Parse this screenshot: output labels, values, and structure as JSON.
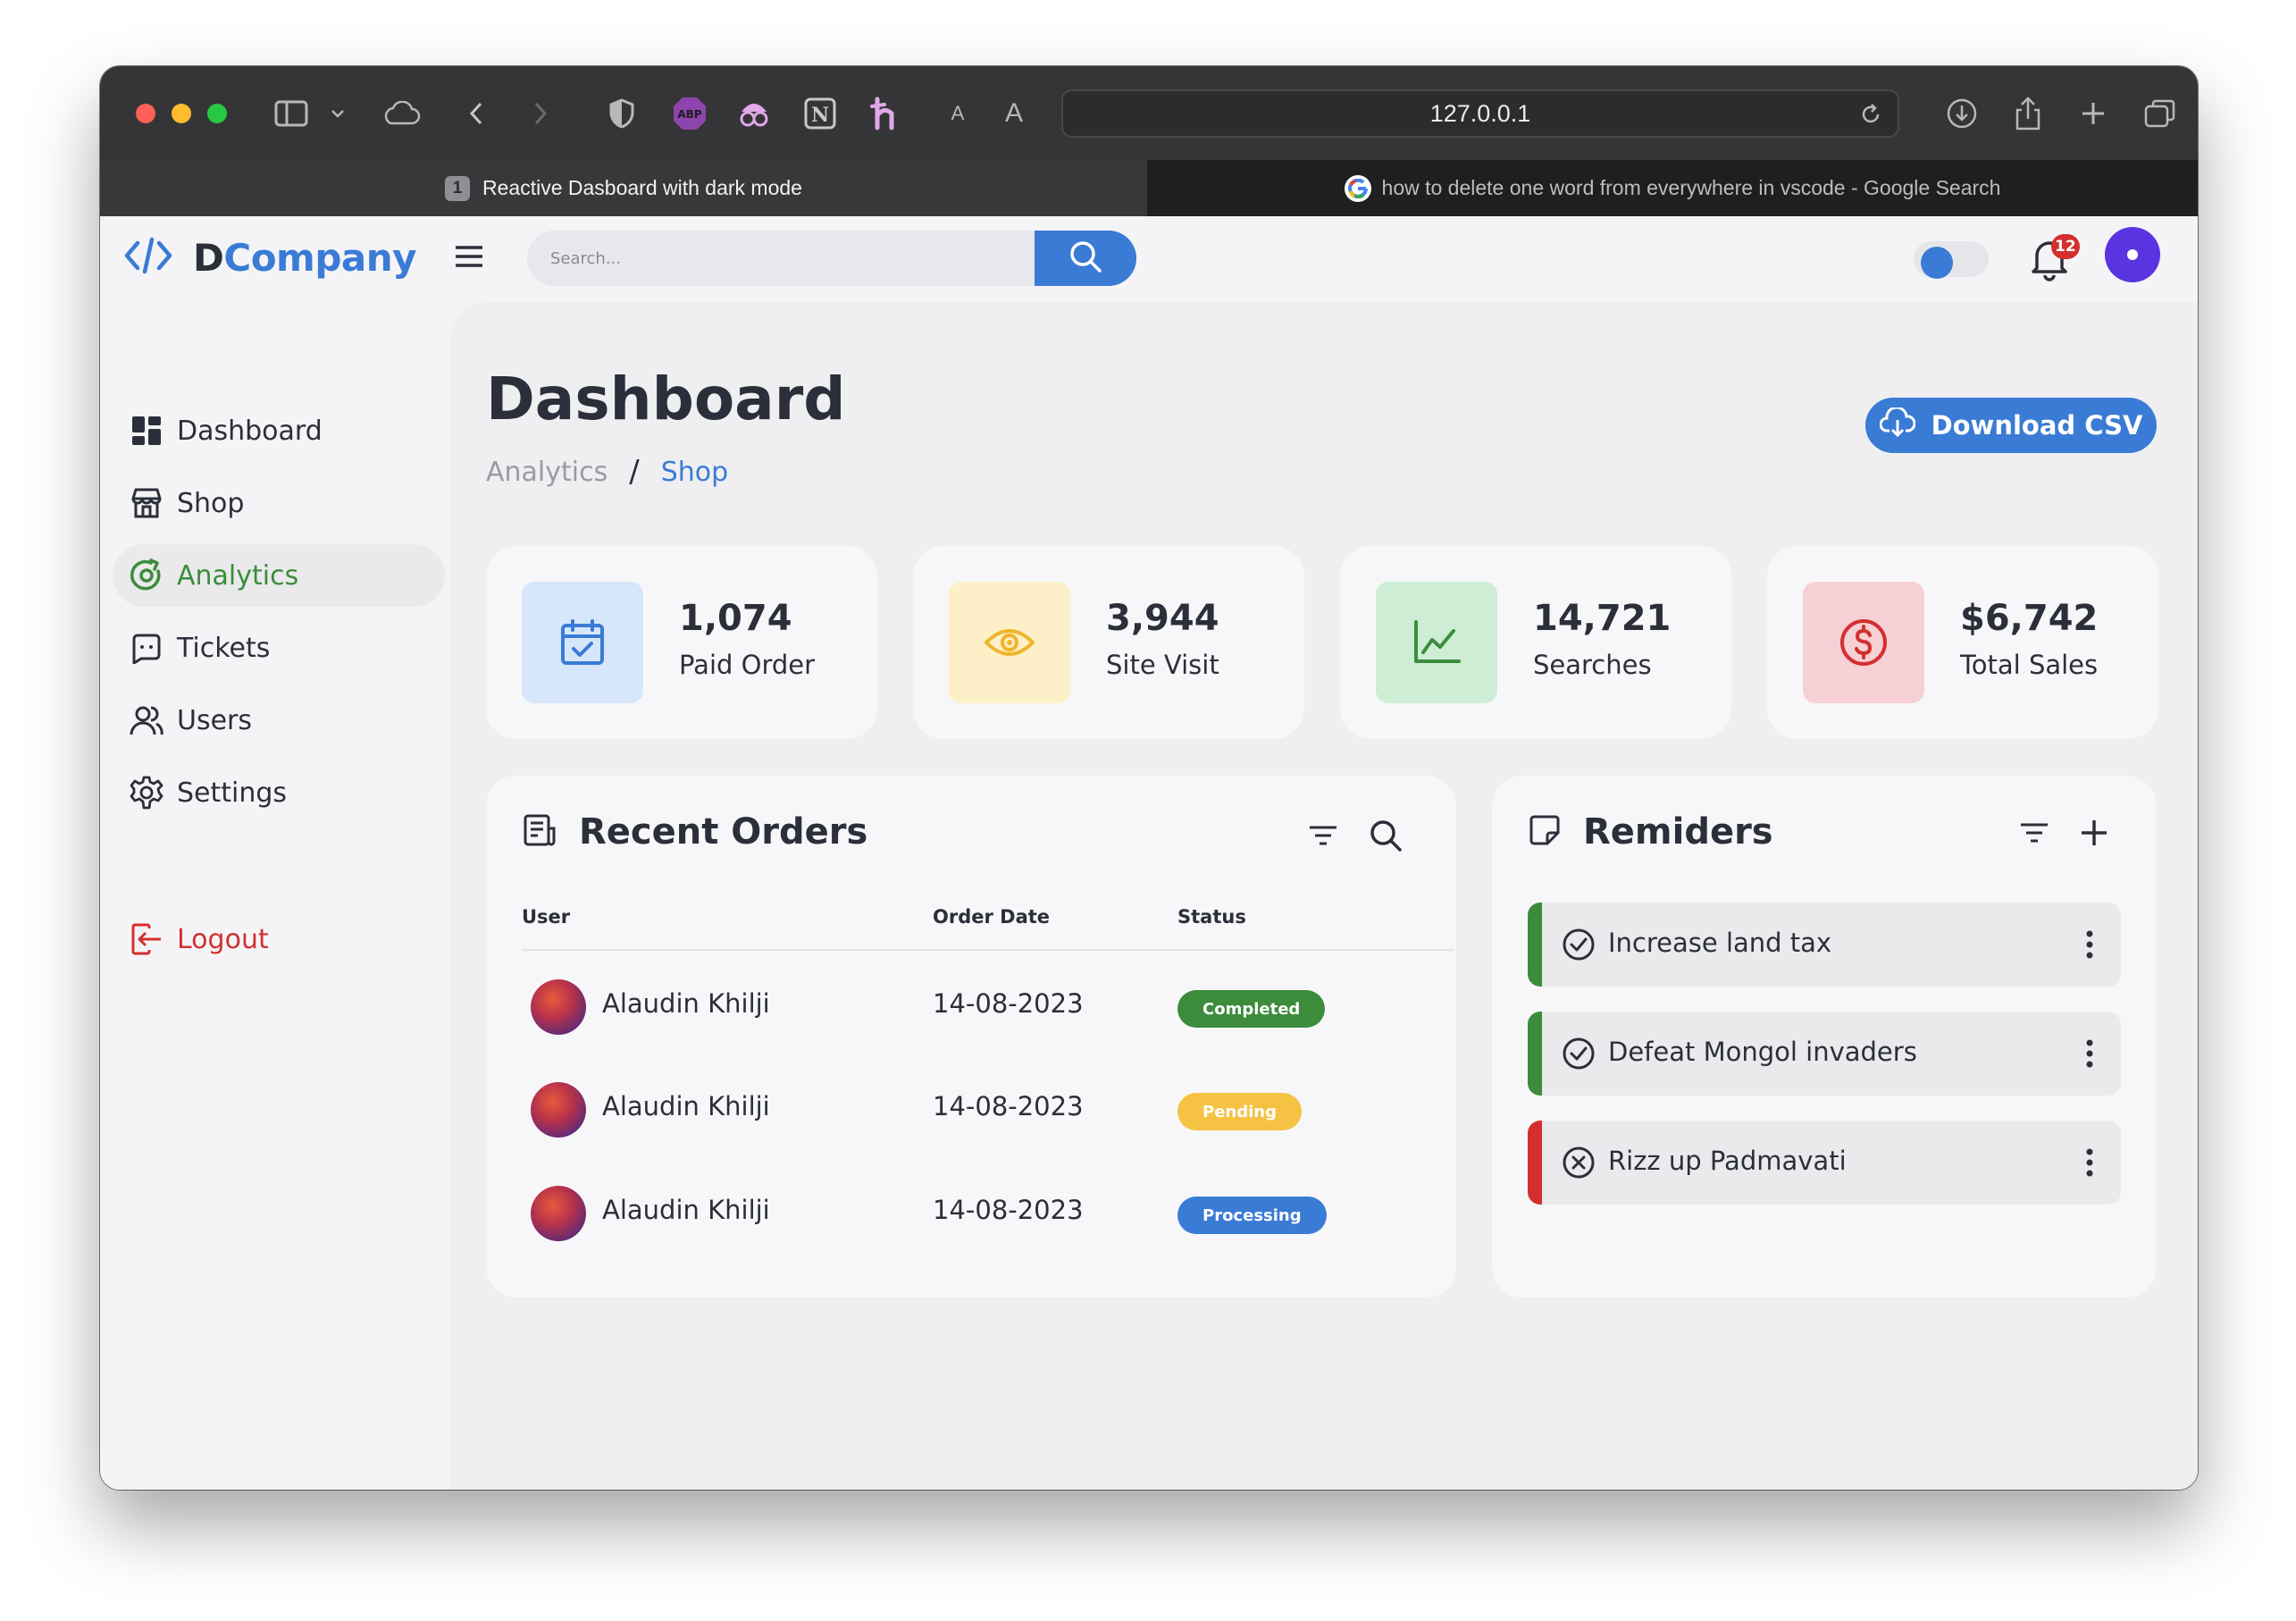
{
  "browser": {
    "url": "127.0.0.1",
    "tabs": [
      {
        "number": "1",
        "title": "Reactive Dasboard with dark mode",
        "active": true
      },
      {
        "title": "how to delete one word from everywhere in vscode - Google Search",
        "active": false
      }
    ],
    "toolbar_icons": [
      "sidebar-icon",
      "chevron-down-icon",
      "cloud-icon",
      "back-icon",
      "forward-icon",
      "shield-icon",
      "adblock-icon",
      "privacy-icon",
      "notion-icon",
      "honey-icon",
      "text-small-icon",
      "text-large-icon",
      "download-icon",
      "share-icon",
      "new-tab-icon",
      "tab-overview-icon"
    ]
  },
  "header": {
    "logo_prefix": "D",
    "logo_suffix": "Company",
    "search_placeholder": "Search...",
    "notification_count": "12"
  },
  "sidebar": {
    "items": [
      {
        "label": "Dashboard",
        "icon": "grid-icon"
      },
      {
        "label": "Shop",
        "icon": "store-icon"
      },
      {
        "label": "Analytics",
        "icon": "analytics-icon",
        "active": true
      },
      {
        "label": "Tickets",
        "icon": "ticket-icon"
      },
      {
        "label": "Users",
        "icon": "users-icon"
      },
      {
        "label": "Settings",
        "icon": "gear-icon"
      }
    ],
    "logout_label": "Logout"
  },
  "main": {
    "title": "Dashboard",
    "breadcrumb": [
      "Analytics",
      "Shop"
    ],
    "breadcrumb_separator": "/",
    "download_label": "Download CSV",
    "stats": [
      {
        "value": "1,074",
        "label": "Paid Order",
        "icon": "calendar-check-icon",
        "bg": "#d6e6fb",
        "fg": "#3a7bd5"
      },
      {
        "value": "3,944",
        "label": "Site Visit",
        "icon": "eye-icon",
        "bg": "#fdf0c8",
        "fg": "#f0b429"
      },
      {
        "value": "14,721",
        "label": "Searches",
        "icon": "line-chart-icon",
        "bg": "#cdeed5",
        "fg": "#3c8c3c"
      },
      {
        "value": "$6,742",
        "label": "Total Sales",
        "icon": "dollar-circle-icon",
        "bg": "#f6d0d4",
        "fg": "#d32f2f"
      }
    ]
  },
  "orders": {
    "title": "Recent Orders",
    "columns": [
      "User",
      "Order Date",
      "Status"
    ],
    "rows": [
      {
        "user": "Alaudin Khilji",
        "date": "14-08-2023",
        "status": "Completed",
        "status_color": "#3c8c3c"
      },
      {
        "user": "Alaudin Khilji",
        "date": "14-08-2023",
        "status": "Pending",
        "status_color": "#f6c244"
      },
      {
        "user": "Alaudin Khilji",
        "date": "14-08-2023",
        "status": "Processing",
        "status_color": "#3a7bd5"
      }
    ]
  },
  "reminders": {
    "title": "Remiders",
    "items": [
      {
        "text": "Increase land tax",
        "state": "done",
        "color": "#3c8c3c"
      },
      {
        "text": "Defeat Mongol invaders",
        "state": "done",
        "color": "#3c8c3c"
      },
      {
        "text": "Rizz up Padmavati",
        "state": "cancelled",
        "color": "#d32f2f"
      }
    ]
  },
  "colors": {
    "accent": "#3a7bd5",
    "success": "#3c8c3c",
    "danger": "#d32f2f",
    "warning": "#f6c244"
  }
}
